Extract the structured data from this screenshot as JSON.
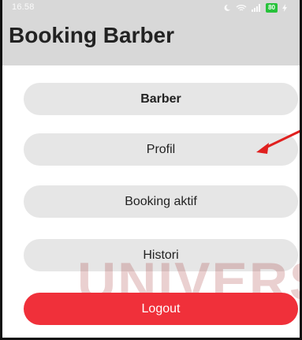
{
  "status_bar": {
    "time": "16.58",
    "battery": "80"
  },
  "app_bar": {
    "title": "Booking Barber"
  },
  "menu": {
    "barber": "Barber",
    "profil": "Profil",
    "booking_aktif": "Booking aktif",
    "histori": "Histori",
    "logout": "Logout"
  },
  "watermark": {
    "text": "UNIVERS"
  },
  "colors": {
    "app_bar": "#d8d8d8",
    "menu_button": "#e6e6e6",
    "logout_button": "#f0303a",
    "annotation_arrow": "#e0201f",
    "battery": "#27c23a"
  },
  "icons": [
    "moon-icon",
    "wifi-icon",
    "signal-icon",
    "battery-icon",
    "charging-icon"
  ]
}
